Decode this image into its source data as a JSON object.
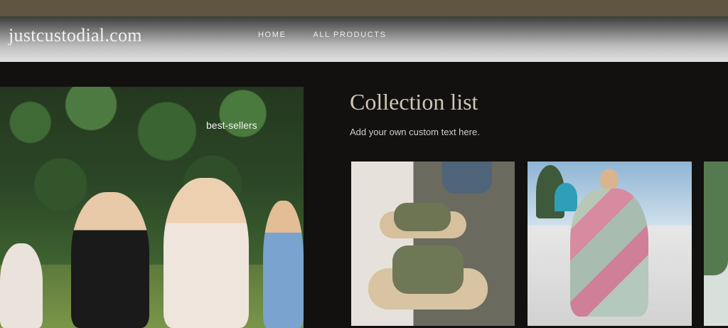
{
  "header": {
    "logo": "justcustodial.com",
    "nav": [
      {
        "label": "HOME"
      },
      {
        "label": "ALL PRODUCTS"
      }
    ]
  },
  "hero": {
    "label": "best-sellers"
  },
  "collection": {
    "title": "Collection list",
    "subtitle": "Add your own custom text here."
  }
}
